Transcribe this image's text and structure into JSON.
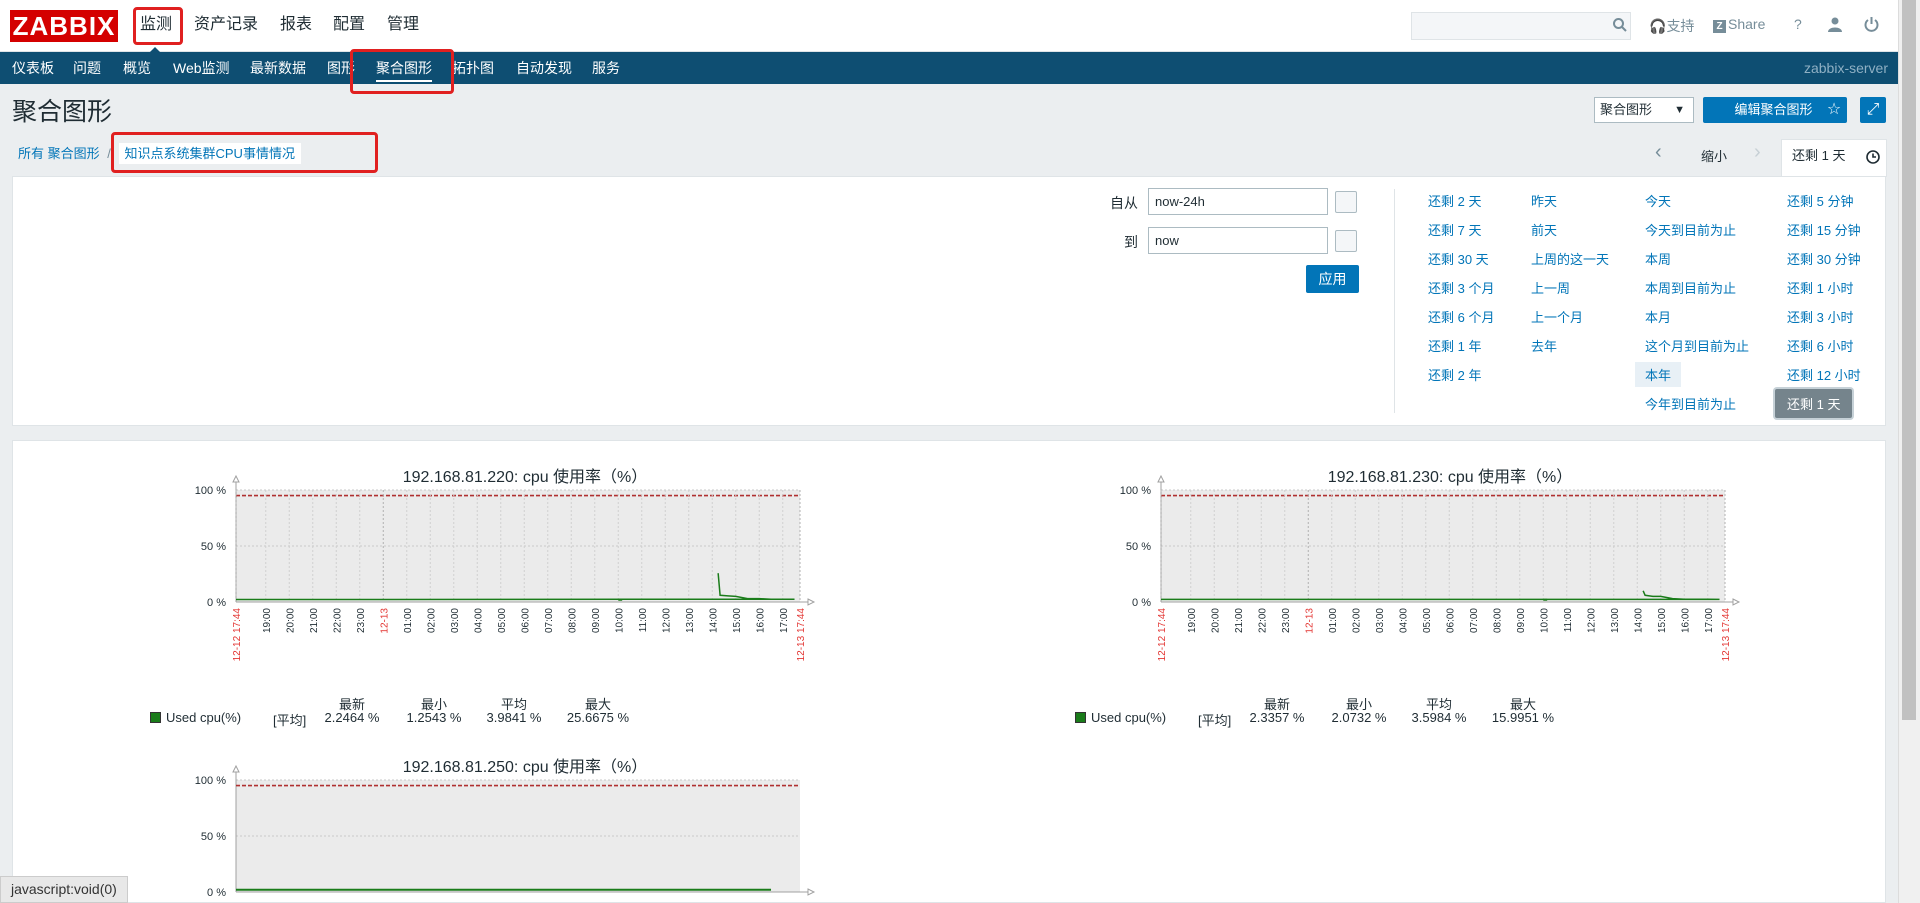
{
  "header": {
    "logo": "ZABBIX",
    "menu": [
      "监测",
      "资产记录",
      "报表",
      "配置",
      "管理"
    ],
    "support": "支持",
    "share": "Share",
    "help": "?"
  },
  "subnav": {
    "items": [
      "仪表板",
      "问题",
      "概览",
      "Web监测",
      "最新数据",
      "图形",
      "聚合图形",
      "拓扑图",
      "自动发现",
      "服务"
    ],
    "server": "zabbix-server"
  },
  "page": {
    "title": "聚合图形",
    "select_value": "聚合图形",
    "edit_button": "编辑聚合图形"
  },
  "breadcrumb": {
    "all": "所有 聚合图形",
    "sep": "/",
    "current": "知识点系统集群CPU事情情况"
  },
  "timebar": {
    "zoom_out": "缩小",
    "range_tab": "还剩 1 天"
  },
  "filter": {
    "from_label": "自从",
    "from_value": "now-24h",
    "to_label": "到",
    "to_value": "now",
    "apply": "应用",
    "quick": [
      [
        "还剩 2 天",
        "还剩 7 天",
        "还剩 30 天",
        "还剩 3 个月",
        "还剩 6 个月",
        "还剩 1 年",
        "还剩 2 年"
      ],
      [
        "昨天",
        "前天",
        "上周的这一天",
        "上一周",
        "上一个月",
        "去年"
      ],
      [
        "今天",
        "今天到目前为止",
        "本周",
        "本周到目前为止",
        "本月",
        "这个月到目前为止",
        "本年",
        "今年到目前为止"
      ],
      [
        "还剩 5 分钟",
        "还剩 15 分钟",
        "还剩 30 分钟",
        "还剩 1 小时",
        "还剩 3 小时",
        "还剩 6 小时",
        "还剩 12 小时",
        "还剩 1 天"
      ]
    ]
  },
  "graphs": [
    {
      "title": "192.168.81.220: cpu 使用率（%）",
      "legend": {
        "series": "Used cpu(%)",
        "func": "[平均]",
        "last": "2.2464 %",
        "min": "1.2543 %",
        "avg": "3.9841 %",
        "max": "25.6675 %"
      }
    },
    {
      "title": "192.168.81.230: cpu 使用率（%）",
      "legend": {
        "series": "Used cpu(%)",
        "func": "[平均]",
        "last": "2.3357 %",
        "min": "2.0732 %",
        "avg": "3.5984 %",
        "max": "15.9951 %"
      }
    },
    {
      "title": "192.168.81.250: cpu 使用率（%）",
      "legend": null
    }
  ],
  "legend_headers": {
    "last": "最新",
    "min": "最小",
    "avg": "平均",
    "max": "最大"
  },
  "chart_data": [
    {
      "type": "line",
      "title": "192.168.81.220: cpu 使用率（%）",
      "y_ticks": [
        "100 %",
        "50 %",
        "0 %"
      ],
      "ylim": [
        0,
        100
      ],
      "x_ticks": [
        "12-12 17:44",
        "19:00",
        "20:00",
        "21:00",
        "22:00",
        "23:00",
        "12-13",
        "01:00",
        "02:00",
        "03:00",
        "04:00",
        "05:00",
        "06:00",
        "07:00",
        "08:00",
        "09:00",
        "10:00",
        "11:00",
        "12:00",
        "13:00",
        "14:00",
        "15:00",
        "16:00",
        "17:00",
        "12-13 17:44"
      ],
      "threshold": 95,
      "series": [
        {
          "name": "Used cpu(%)",
          "x": [
            "10:00",
            "10:10",
            "14:15",
            "14:20",
            "14:40",
            "15:00",
            "15:30",
            "16:00",
            "16:30",
            "17:00",
            "17:30",
            "17:44"
          ],
          "values": [
            2,
            2,
            25.7,
            6,
            5.5,
            5,
            3,
            3,
            2.5,
            2.5,
            2.5,
            2.2
          ]
        }
      ]
    },
    {
      "type": "line",
      "title": "192.168.81.230: cpu 使用率（%）",
      "y_ticks": [
        "100 %",
        "50 %",
        "0 %"
      ],
      "ylim": [
        0,
        100
      ],
      "x_ticks": [
        "12-12 17:44",
        "19:00",
        "20:00",
        "21:00",
        "22:00",
        "23:00",
        "12-13",
        "01:00",
        "02:00",
        "03:00",
        "04:00",
        "05:00",
        "06:00",
        "07:00",
        "08:00",
        "09:00",
        "10:00",
        "11:00",
        "12:00",
        "13:00",
        "14:00",
        "15:00",
        "16:00",
        "17:00",
        "12-13 17:44"
      ],
      "threshold": 95,
      "series": [
        {
          "name": "Used cpu(%)",
          "x": [
            "10:00",
            "10:10",
            "14:15",
            "14:20",
            "14:40",
            "15:00",
            "15:30",
            "16:00",
            "16:30",
            "17:00",
            "17:30",
            "17:44"
          ],
          "values": [
            2,
            2,
            10,
            6,
            5,
            5,
            3,
            2.5,
            2.5,
            2.5,
            2.3,
            2.3
          ]
        }
      ]
    },
    {
      "type": "line",
      "title": "192.168.81.250: cpu 使用率（%）",
      "y_ticks": [
        "100 %",
        "50 %",
        "0 %"
      ],
      "ylim": [
        0,
        100
      ],
      "threshold": 95,
      "series": [
        {
          "name": "Used cpu(%)",
          "x": [
            "16:30",
            "17:44"
          ],
          "values": [
            2,
            2
          ]
        }
      ]
    }
  ]
}
